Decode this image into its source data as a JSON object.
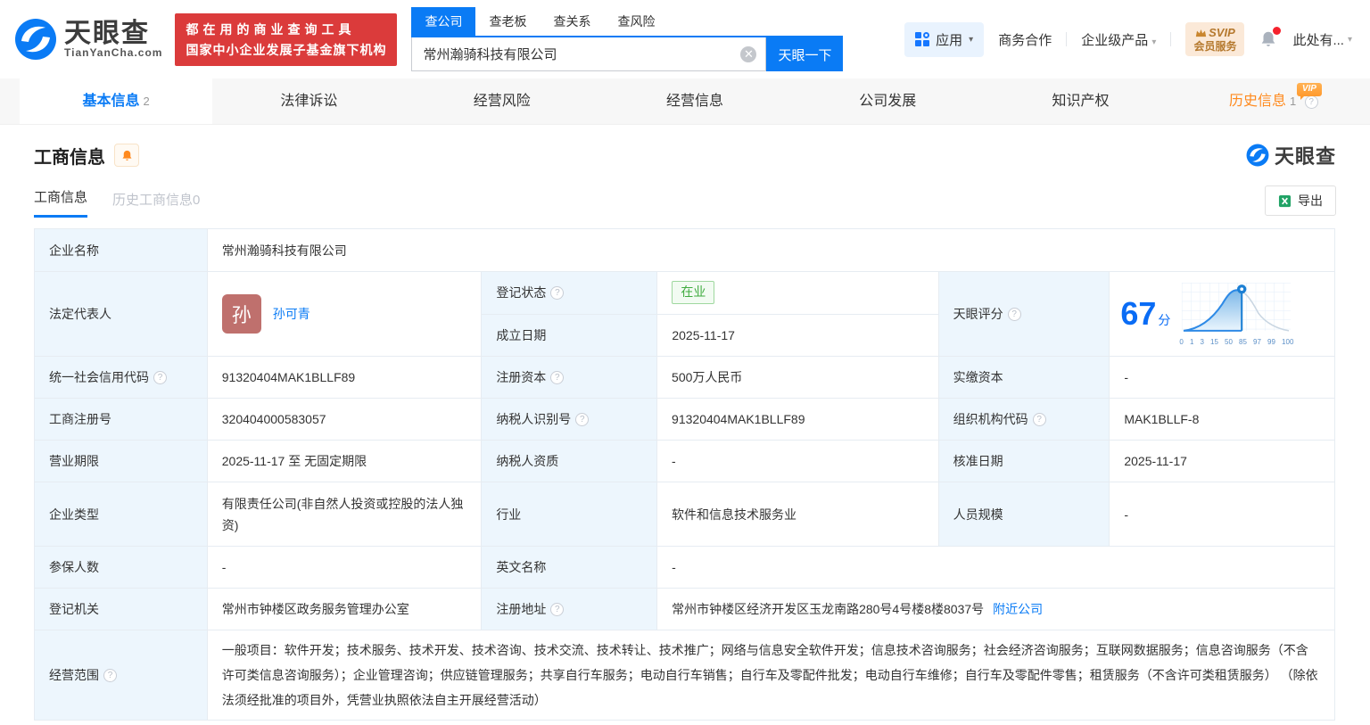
{
  "brand": {
    "name": "天眼查",
    "domain": "TianYanCha.com",
    "slogan1": "都在用的商业查询工具",
    "slogan2": "国家中小企业发展子基金旗下机构"
  },
  "search": {
    "tabs": [
      "查公司",
      "查老板",
      "查关系",
      "查风险"
    ],
    "value": "常州瀚骑科技有限公司",
    "button": "天眼一下"
  },
  "topnav": {
    "apps": "应用",
    "cooperation": "商务合作",
    "enterprise": "企业级产品",
    "svip_top": "SVIP",
    "svip_bottom": "会员服务",
    "account": "此处有..."
  },
  "tabs": {
    "t0": "基本信息",
    "t0_count": "2",
    "t1": "法律诉讼",
    "t2": "经营风险",
    "t3": "经营信息",
    "t4": "公司发展",
    "t5": "知识产权",
    "t6": "历史信息",
    "t6_count": "1",
    "vip": "VIP"
  },
  "section": {
    "title": "工商信息",
    "subtab_active": "工商信息",
    "subtab_history": "历史工商信息0",
    "watermark": "天眼查",
    "export": "导出"
  },
  "info": {
    "name_label": "企业名称",
    "name": "常州瀚骑科技有限公司",
    "legal_label": "法定代表人",
    "legal_avatar": "孙",
    "legal_name": "孙可青",
    "status_label": "登记状态",
    "status": "在业",
    "established_label": "成立日期",
    "established": "2025-11-17",
    "score_label": "天眼评分",
    "score": "67",
    "score_unit": "分",
    "axis": [
      "0",
      "1",
      "3",
      "15",
      "50",
      "85",
      "97",
      "99",
      "100"
    ],
    "credit_label": "统一社会信用代码",
    "credit": "91320404MAK1BLLF89",
    "capital_label": "注册资本",
    "capital": "500万人民币",
    "paid_label": "实缴资本",
    "paid": "-",
    "regno_label": "工商注册号",
    "regno": "320404000583057",
    "taxid_label": "纳税人识别号",
    "taxid": "91320404MAK1BLLF89",
    "orgcode_label": "组织机构代码",
    "orgcode": "MAK1BLLF-8",
    "term_label": "营业期限",
    "term": "2025-11-17 至 无固定期限",
    "taxq_label": "纳税人资质",
    "taxq": "-",
    "approved_label": "核准日期",
    "approved": "2025-11-17",
    "type_label": "企业类型",
    "type": "有限责任公司(非自然人投资或控股的法人独资)",
    "industry_label": "行业",
    "industry": "软件和信息技术服务业",
    "staff_label": "人员规模",
    "staff": "-",
    "insured_label": "参保人数",
    "insured": "-",
    "english_label": "英文名称",
    "english": "-",
    "authority_label": "登记机关",
    "authority": "常州市钟楼区政务服务管理办公室",
    "address_label": "注册地址",
    "address": "常州市钟楼区经济开发区玉龙南路280号4号楼8楼8037号",
    "address_link": "附近公司",
    "scope_label": "经营范围",
    "scope": "一般项目：软件开发；技术服务、技术开发、技术咨询、技术交流、技术转让、技术推广；网络与信息安全软件开发；信息技术咨询服务；社会经济咨询服务；互联网数据服务；信息咨询服务（不含许可类信息咨询服务）；企业管理咨询；供应链管理服务；共享自行车服务；电动自行车销售；自行车及零配件批发；电动自行车维修；自行车及零配件零售；租赁服务（不含许可类租赁服务） （除依法须经批准的项目外，凭营业执照依法自主开展经营活动）"
  }
}
